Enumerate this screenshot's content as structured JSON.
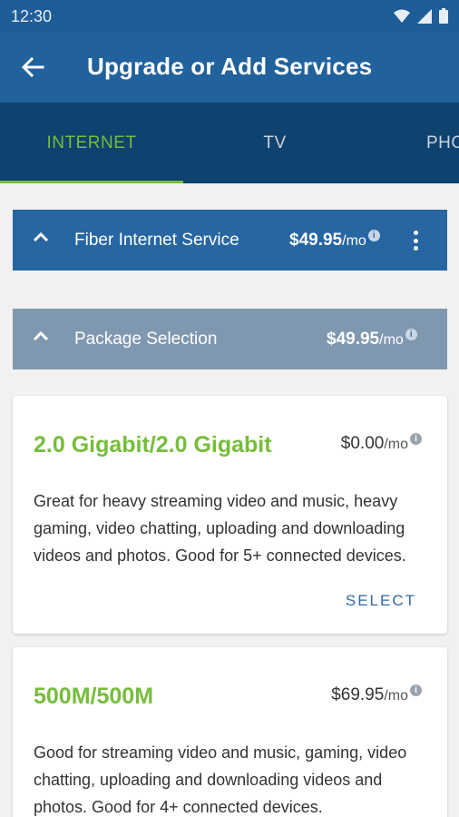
{
  "status_bar": {
    "time": "12:30"
  },
  "app_bar": {
    "title": "Upgrade or Add Services"
  },
  "tabs": [
    {
      "label": "INTERNET",
      "active": true
    },
    {
      "label": "TV",
      "active": false
    },
    {
      "label": "PHONE",
      "active": false
    }
  ],
  "fiber_section": {
    "label": "Fiber Internet Service",
    "price": "$49.95",
    "unit": "/mo"
  },
  "package_section": {
    "label": "Package Selection",
    "price": "$49.95",
    "unit": "/mo"
  },
  "packages": [
    {
      "title": "2.0 Gigabit/2.0 Gigabit",
      "price": "$0.00",
      "unit": "/mo",
      "description": "Great for heavy streaming video and music, heavy gaming, video chatting, uploading and downloading videos and photos. Good for 5+ connected devices.",
      "action": "SELECT"
    },
    {
      "title": "500M/500M",
      "price": "$69.95",
      "unit": "/mo",
      "description": "Good for streaming video and music, gaming, video chatting, uploading and downloading videos and photos. Good for 4+ connected devices."
    }
  ],
  "colors": {
    "app_bar": "#21619c",
    "tabs_bg": "#10426f",
    "accent_green": "#76bd3c",
    "fiber_row": "#2766a1",
    "package_row": "#7f98af"
  }
}
